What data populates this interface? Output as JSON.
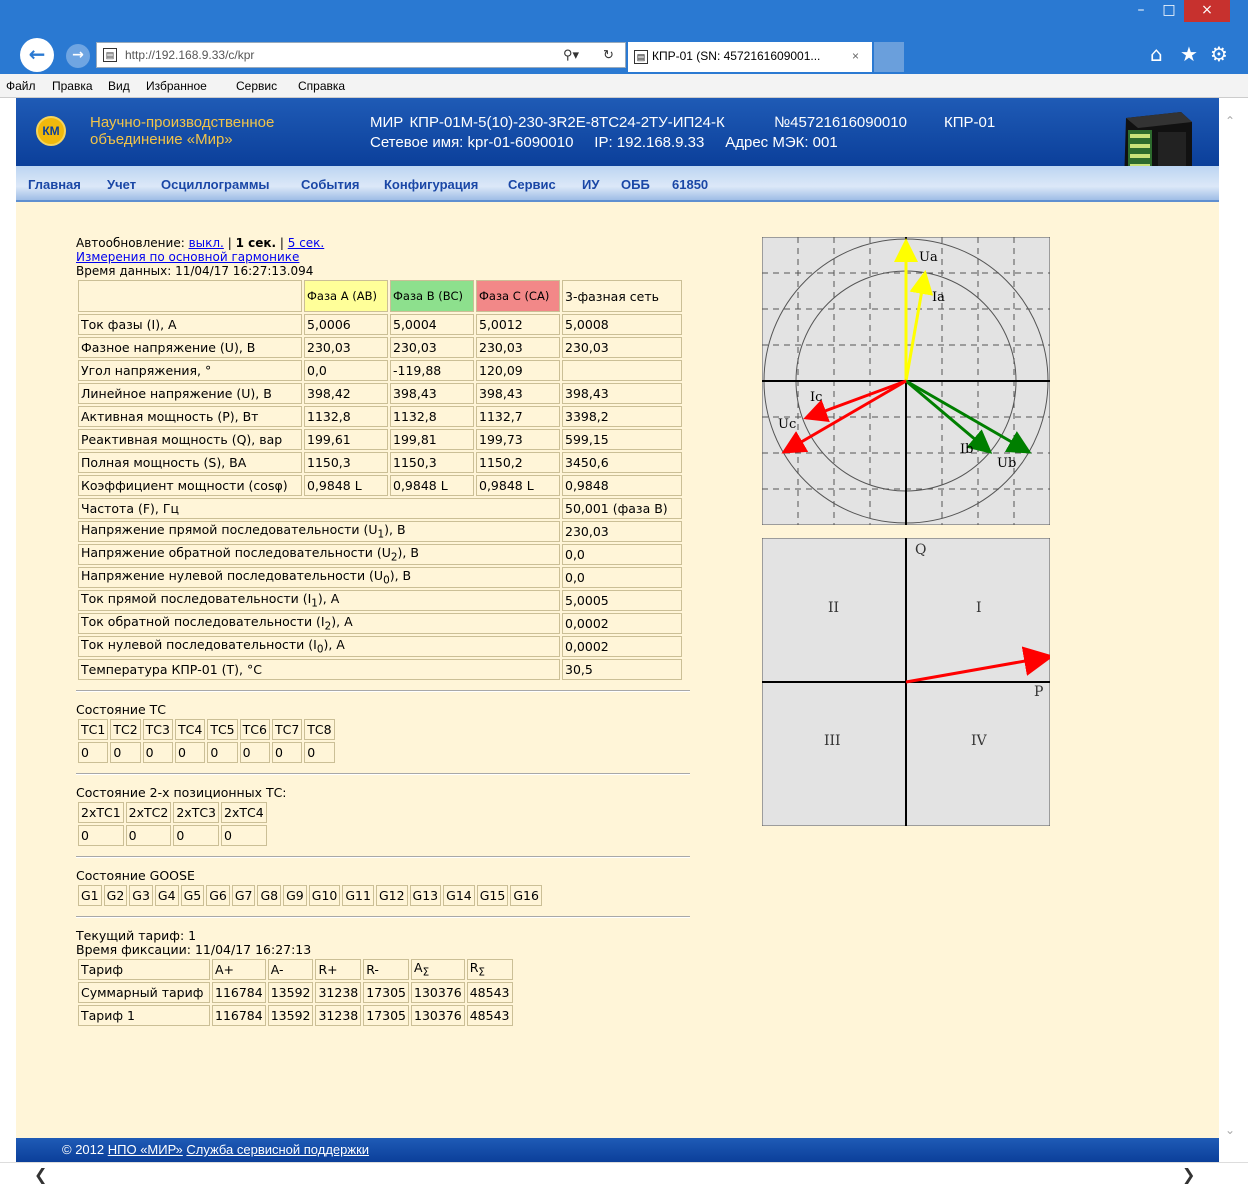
{
  "browser": {
    "url": "http://192.168.9.33/c/kpr",
    "tab_title": "КПР-01 (SN: 4572161609001...",
    "tab_close": "×",
    "menu": [
      "Файл",
      "Правка",
      "Вид",
      "Избранное",
      "Сервис",
      "Справка"
    ],
    "window_controls": {
      "minimize": "–",
      "maximize": "□",
      "close": "×"
    }
  },
  "header": {
    "logo_text": "КМ",
    "company_line1": "Научно-производственное",
    "company_line2": "объединение «Мир»",
    "device_model": "МИР КПР-01М-5(10)-230-3R2E-8ТС24-2ТУ-ИП24-К",
    "device_serial": "№45721616090010",
    "device_short": "КПР-01",
    "network_name": "Сетевое имя: kpr-01-6090010",
    "ip": "IP: 192.168.9.33",
    "iec_address": "Адрес МЭК: 001"
  },
  "nav": [
    "Главная",
    "Учет",
    "Осциллограммы",
    "События",
    "Конфигурация",
    "Сервис",
    "ИУ",
    "ОББ",
    "61850"
  ],
  "autoupdate": {
    "label": "Автообновление:",
    "off": "выкл.",
    "sep1": "|",
    "current": "1 сек.",
    "sep2": "|",
    "five": "5 сек."
  },
  "harmonic_link": "Измерения по основной гармонике",
  "data_time": "Время данных: 11/04/17 16:27:13.094",
  "measurements": {
    "headers": [
      "Фаза A (AB)",
      "Фаза B (BC)",
      "Фаза C (CA)",
      "3-фазная сеть"
    ],
    "rows": [
      {
        "label": "Ток фазы (I), А",
        "a": "5,0006",
        "b": "5,0004",
        "c": "5,0012",
        "t": "5,0008"
      },
      {
        "label": "Фазное напряжение (U), В",
        "a": "230,03",
        "b": "230,03",
        "c": "230,03",
        "t": "230,03"
      },
      {
        "label": "Угол напряжения, °",
        "a": "0,0",
        "b": "-119,88",
        "c": "120,09",
        "t": ""
      },
      {
        "label": "Линейное напряжение (U), В",
        "a": "398,42",
        "b": "398,43",
        "c": "398,43",
        "t": "398,43"
      },
      {
        "label": "Активная мощность (P), Вт",
        "a": "1132,8",
        "b": "1132,8",
        "c": "1132,7",
        "t": "3398,2"
      },
      {
        "label": "Реактивная мощность (Q), вар",
        "a": "199,61",
        "b": "199,81",
        "c": "199,73",
        "t": "599,15"
      },
      {
        "label": "Полная мощность (S), ВА",
        "a": "1150,3",
        "b": "1150,3",
        "c": "1150,2",
        "t": "3450,6"
      },
      {
        "label": "Коэффициент мощности (cosφ)",
        "a": "0,9848 L",
        "b": "0,9848 L",
        "c": "0,9848 L",
        "t": "0,9848"
      }
    ],
    "frequency": {
      "label": "Частота (F), Гц",
      "value": "50,001 (фаза B)"
    },
    "sequence": [
      {
        "pre": "Напряжение прямой последовательности (U",
        "sub": "1",
        "post": "),  В",
        "value": "230,03"
      },
      {
        "pre": "Напряжение обратной последовательности (U",
        "sub": "2",
        "post": "),  В",
        "value": "0,0"
      },
      {
        "pre": "Напряжение нулевой последовательности (U",
        "sub": "0",
        "post": "),  В",
        "value": "0,0"
      },
      {
        "pre": "Ток прямой последовательности (I",
        "sub": "1",
        "post": "),  А",
        "value": "5,0005"
      },
      {
        "pre": "Ток обратной последовательности (I",
        "sub": "2",
        "post": "),  А",
        "value": "0,0002"
      },
      {
        "pre": "Ток нулевой последовательности (I",
        "sub": "0",
        "post": "),  А",
        "value": "0,0002"
      }
    ],
    "temperature": {
      "label": "Температура КПР-01 (T), °C",
      "value": "30,5"
    }
  },
  "tc_state": {
    "title": "Состояние ТС",
    "headers": [
      "ТС1",
      "ТС2",
      "ТС3",
      "ТС4",
      "ТС5",
      "ТС6",
      "ТС7",
      "ТС8"
    ],
    "values": [
      "0",
      "0",
      "0",
      "0",
      "0",
      "0",
      "0",
      "0"
    ]
  },
  "tc2_state": {
    "title": "Состояние 2-х позиционных ТС:",
    "headers": [
      "2хТС1",
      "2хТС2",
      "2хТС3",
      "2хТС4"
    ],
    "values": [
      "0",
      "0",
      "0",
      "0"
    ]
  },
  "goose": {
    "title": "Состояние GOOSE",
    "items": [
      "G1",
      "G2",
      "G3",
      "G4",
      "G5",
      "G6",
      "G7",
      "G8",
      "G9",
      "G10",
      "G11",
      "G12",
      "G13",
      "G14",
      "G15",
      "G16"
    ]
  },
  "tariff": {
    "current": "Текущий тариф: 1",
    "fix_time": "Время фиксации: 11/04/17 16:27:13",
    "headers": [
      "Тариф",
      "A+",
      "A-",
      "R+",
      "R-"
    ],
    "sum_headers": [
      {
        "letter": "A",
        "sub": "Σ"
      },
      {
        "letter": "R",
        "sub": "Σ"
      }
    ],
    "rows": [
      [
        "Суммарный тариф",
        "116784",
        "13592",
        "31238",
        "17305",
        "130376",
        "48543"
      ],
      [
        "Тариф 1",
        "116784",
        "13592",
        "31238",
        "17305",
        "130376",
        "48543"
      ]
    ]
  },
  "vector_diagram": {
    "labels": {
      "ua": "Ua",
      "ia": "Ia",
      "ub": "Ub",
      "ib": "Ib",
      "uc": "Uc",
      "ic": "Ic"
    },
    "angles_deg": {
      "ua": 0.0,
      "ub": -119.88,
      "uc": 120.09,
      "ia": -10,
      "ib": -130,
      "ic": 110
    },
    "colors": {
      "a": "#ffff00",
      "b": "#007f00",
      "c": "#ff0000"
    }
  },
  "pq_diagram": {
    "axis_q": "Q",
    "axis_p": "P",
    "quadrants": [
      "II",
      "I",
      "III",
      "IV"
    ],
    "p": 3398.2,
    "q": 599.15,
    "arrow_color": "#ff0000"
  },
  "footer": {
    "copyright": "© 2012",
    "company_link": "НПО «МИР»",
    "support_link": "Служба сервисной поддержки"
  }
}
